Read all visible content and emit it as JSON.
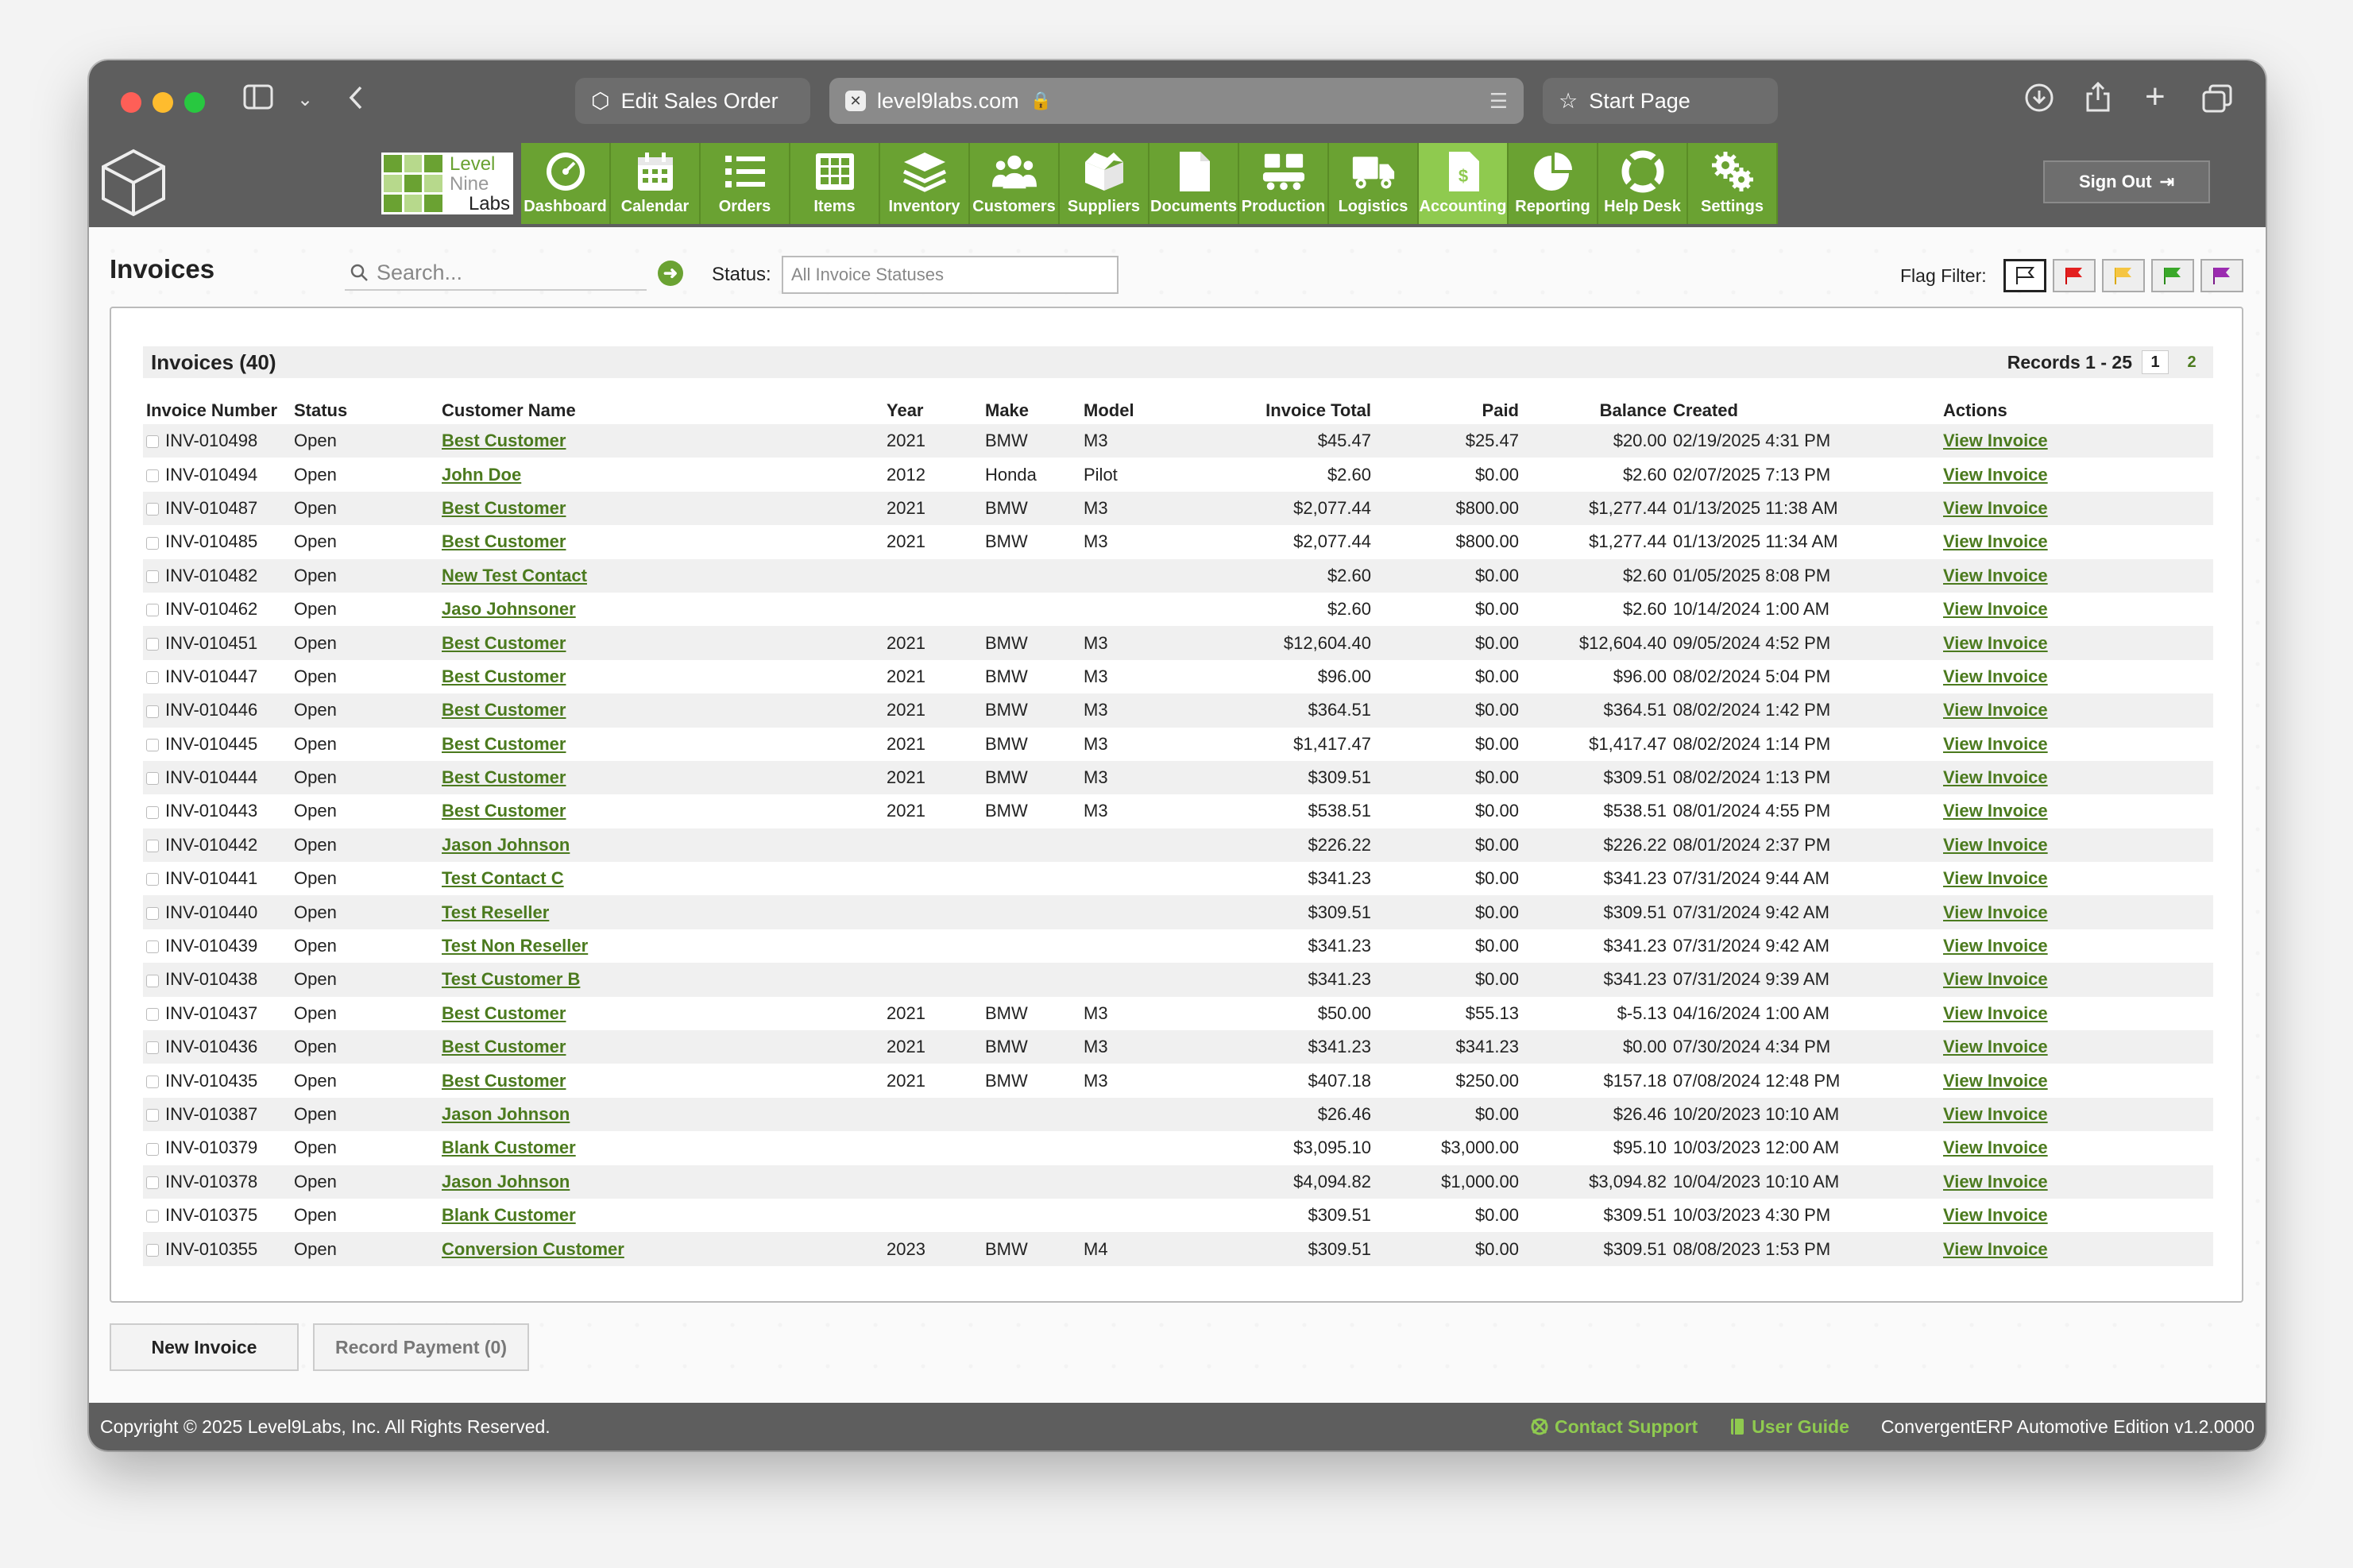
{
  "browser": {
    "tabs": [
      "Edit Sales Order",
      "level9labs.com",
      "Start Page"
    ]
  },
  "brand": {
    "line1": "Level",
    "line2": "Nine",
    "line3": "Labs"
  },
  "nav": [
    {
      "label": "Dashboard",
      "icon": "dashboard-icon"
    },
    {
      "label": "Calendar",
      "icon": "calendar-icon"
    },
    {
      "label": "Orders",
      "icon": "list-icon"
    },
    {
      "label": "Items",
      "icon": "grid-icon"
    },
    {
      "label": "Inventory",
      "icon": "layers-icon"
    },
    {
      "label": "Customers",
      "icon": "people-icon"
    },
    {
      "label": "Suppliers",
      "icon": "box-icon"
    },
    {
      "label": "Documents",
      "icon": "document-icon"
    },
    {
      "label": "Production",
      "icon": "production-icon"
    },
    {
      "label": "Logistics",
      "icon": "truck-icon"
    },
    {
      "label": "Accounting",
      "icon": "invoice-icon",
      "active": true
    },
    {
      "label": "Reporting",
      "icon": "pie-chart-icon"
    },
    {
      "label": "Help Desk",
      "icon": "lifebuoy-icon"
    },
    {
      "label": "Settings",
      "icon": "gears-icon"
    }
  ],
  "signout": "Sign Out",
  "page": {
    "title": "Invoices",
    "search_placeholder": "Search...",
    "status_label": "Status:",
    "status_value": "All Invoice Statuses",
    "flag_label": "Flag Filter:"
  },
  "panel": {
    "title": "Invoices (40)",
    "records": "Records 1 - 25",
    "pages": [
      "1",
      "2"
    ]
  },
  "columns": [
    "Invoice Number",
    "Status",
    "Customer Name",
    "Year",
    "Make",
    "Model",
    "Invoice Total",
    "Paid",
    "Balance",
    "Created",
    "Actions"
  ],
  "rows": [
    [
      "INV-010498",
      "Open",
      "Best Customer",
      "2021",
      "BMW",
      "M3",
      "$45.47",
      "$25.47",
      "$20.00",
      "02/19/2025 4:31 PM",
      "View Invoice"
    ],
    [
      "INV-010494",
      "Open",
      "John Doe",
      "2012",
      "Honda",
      "Pilot",
      "$2.60",
      "$0.00",
      "$2.60",
      "02/07/2025 7:13 PM",
      "View Invoice"
    ],
    [
      "INV-010487",
      "Open",
      "Best Customer",
      "2021",
      "BMW",
      "M3",
      "$2,077.44",
      "$800.00",
      "$1,277.44",
      "01/13/2025 11:38 AM",
      "View Invoice"
    ],
    [
      "INV-010485",
      "Open",
      "Best Customer",
      "2021",
      "BMW",
      "M3",
      "$2,077.44",
      "$800.00",
      "$1,277.44",
      "01/13/2025 11:34 AM",
      "View Invoice"
    ],
    [
      "INV-010482",
      "Open",
      "New Test Contact",
      "",
      "",
      "",
      "$2.60",
      "$0.00",
      "$2.60",
      "01/05/2025 8:08 PM",
      "View Invoice"
    ],
    [
      "INV-010462",
      "Open",
      "Jaso Johnsoner",
      "",
      "",
      "",
      "$2.60",
      "$0.00",
      "$2.60",
      "10/14/2024 1:00 AM",
      "View Invoice"
    ],
    [
      "INV-010451",
      "Open",
      "Best Customer",
      "2021",
      "BMW",
      "M3",
      "$12,604.40",
      "$0.00",
      "$12,604.40",
      "09/05/2024 4:52 PM",
      "View Invoice"
    ],
    [
      "INV-010447",
      "Open",
      "Best Customer",
      "2021",
      "BMW",
      "M3",
      "$96.00",
      "$0.00",
      "$96.00",
      "08/02/2024 5:04 PM",
      "View Invoice"
    ],
    [
      "INV-010446",
      "Open",
      "Best Customer",
      "2021",
      "BMW",
      "M3",
      "$364.51",
      "$0.00",
      "$364.51",
      "08/02/2024 1:42 PM",
      "View Invoice"
    ],
    [
      "INV-010445",
      "Open",
      "Best Customer",
      "2021",
      "BMW",
      "M3",
      "$1,417.47",
      "$0.00",
      "$1,417.47",
      "08/02/2024 1:14 PM",
      "View Invoice"
    ],
    [
      "INV-010444",
      "Open",
      "Best Customer",
      "2021",
      "BMW",
      "M3",
      "$309.51",
      "$0.00",
      "$309.51",
      "08/02/2024 1:13 PM",
      "View Invoice"
    ],
    [
      "INV-010443",
      "Open",
      "Best Customer",
      "2021",
      "BMW",
      "M3",
      "$538.51",
      "$0.00",
      "$538.51",
      "08/01/2024 4:55 PM",
      "View Invoice"
    ],
    [
      "INV-010442",
      "Open",
      "Jason Johnson",
      "",
      "",
      "",
      "$226.22",
      "$0.00",
      "$226.22",
      "08/01/2024 2:37 PM",
      "View Invoice"
    ],
    [
      "INV-010441",
      "Open",
      "Test Contact C",
      "",
      "",
      "",
      "$341.23",
      "$0.00",
      "$341.23",
      "07/31/2024 9:44 AM",
      "View Invoice"
    ],
    [
      "INV-010440",
      "Open",
      "Test Reseller",
      "",
      "",
      "",
      "$309.51",
      "$0.00",
      "$309.51",
      "07/31/2024 9:42 AM",
      "View Invoice"
    ],
    [
      "INV-010439",
      "Open",
      "Test Non Reseller",
      "",
      "",
      "",
      "$341.23",
      "$0.00",
      "$341.23",
      "07/31/2024 9:42 AM",
      "View Invoice"
    ],
    [
      "INV-010438",
      "Open",
      "Test Customer B",
      "",
      "",
      "",
      "$341.23",
      "$0.00",
      "$341.23",
      "07/31/2024 9:39 AM",
      "View Invoice"
    ],
    [
      "INV-010437",
      "Open",
      "Best Customer",
      "2021",
      "BMW",
      "M3",
      "$50.00",
      "$55.13",
      "$-5.13",
      "04/16/2024 1:00 AM",
      "View Invoice"
    ],
    [
      "INV-010436",
      "Open",
      "Best Customer",
      "2021",
      "BMW",
      "M3",
      "$341.23",
      "$341.23",
      "$0.00",
      "07/30/2024 4:34 PM",
      "View Invoice"
    ],
    [
      "INV-010435",
      "Open",
      "Best Customer",
      "2021",
      "BMW",
      "M3",
      "$407.18",
      "$250.00",
      "$157.18",
      "07/08/2024 12:48 PM",
      "View Invoice"
    ],
    [
      "INV-010387",
      "Open",
      "Jason Johnson",
      "",
      "",
      "",
      "$26.46",
      "$0.00",
      "$26.46",
      "10/20/2023 10:10 AM",
      "View Invoice"
    ],
    [
      "INV-010379",
      "Open",
      "Blank Customer",
      "",
      "",
      "",
      "$3,095.10",
      "$3,000.00",
      "$95.10",
      "10/03/2023 12:00 AM",
      "View Invoice"
    ],
    [
      "INV-010378",
      "Open",
      "Jason Johnson",
      "",
      "",
      "",
      "$4,094.82",
      "$1,000.00",
      "$3,094.82",
      "10/04/2023 10:10 AM",
      "View Invoice"
    ],
    [
      "INV-010375",
      "Open",
      "Blank Customer",
      "",
      "",
      "",
      "$309.51",
      "$0.00",
      "$309.51",
      "10/03/2023 4:30 PM",
      "View Invoice"
    ],
    [
      "INV-010355",
      "Open",
      "Conversion Customer",
      "2023",
      "BMW",
      "M4",
      "$309.51",
      "$0.00",
      "$309.51",
      "08/08/2023 1:53 PM",
      "View Invoice"
    ]
  ],
  "buttons": {
    "new_invoice": "New Invoice",
    "record_payment": "Record Payment (0)"
  },
  "footer": {
    "copyright": "Copyright © 2025 Level9Labs, Inc. All Rights Reserved.",
    "support": "Contact Support",
    "guide": "User Guide",
    "edition": "ConvergentERP Automotive Edition v1.2.0000"
  },
  "colors": {
    "brand_green": "#6aa232",
    "active_green": "#8fca4f",
    "link_green": "#4b7a1e",
    "chrome_gray": "#5e5e5e"
  }
}
